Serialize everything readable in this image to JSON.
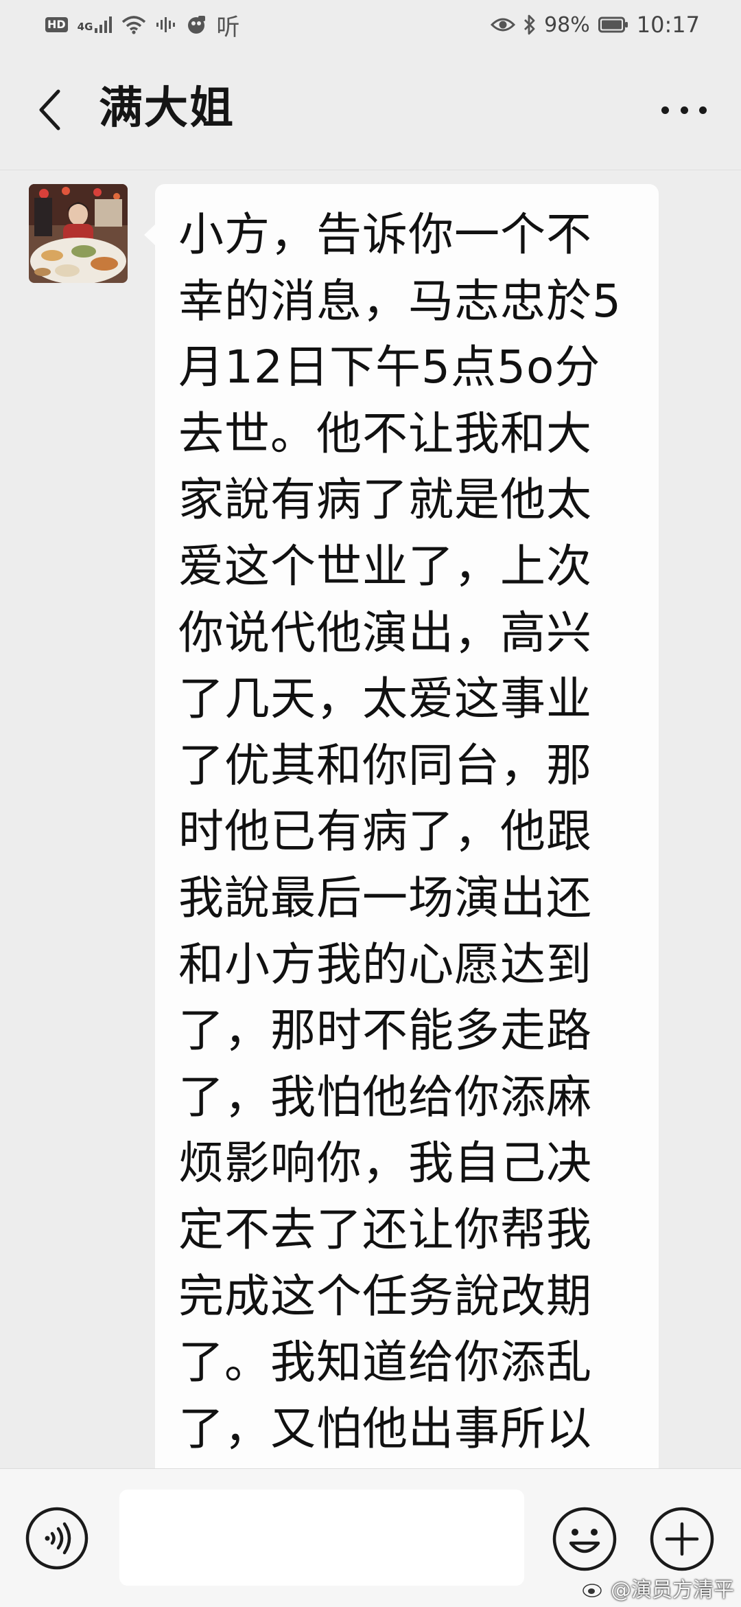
{
  "status_bar": {
    "hd": "HD",
    "network": "4G",
    "ting": "听",
    "battery": "98%",
    "time": "10:17"
  },
  "header": {
    "title": "满大姐"
  },
  "messages": [
    {
      "sender": "other",
      "text": "小方，告诉你一个不幸的消息，马志忠於5月12日下午5点5o分去世。他不让我和大家說有病了就是他太爱这个世业了，上次你说代他演出，高兴了几天，太爱这事业了优其和你同台，那时他已有病了，他跟我說最后一场演出还和小方我的心愿达到了，那时不能多走路了，我怕他给你添麻烦影响你，我自己决定不去了还让你帮我完成这个任务說改期了。我知道给你添乱了，又怕他出事所以"
    }
  ],
  "input": {
    "value": ""
  },
  "watermark": {
    "text": "@演员方清平"
  },
  "icons": {
    "back": "chevron-left-icon",
    "more": "more-dots-icon",
    "voice": "voice-icon",
    "emoji": "emoji-icon",
    "add": "plus-icon"
  }
}
